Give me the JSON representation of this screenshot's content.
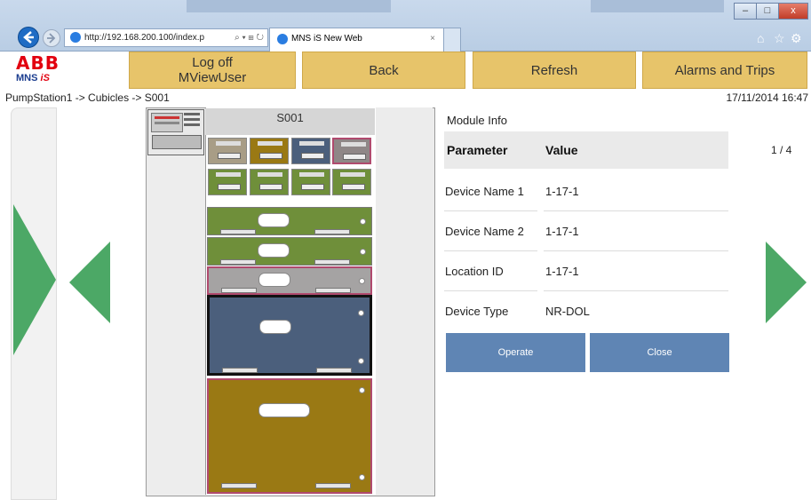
{
  "browser": {
    "url": "http://192.168.200.100/index.p",
    "url_tools": "⌕ ▾ ⊞ ↻",
    "tab_title": "MNS iS New Web",
    "tab_close": "×",
    "window_controls": {
      "minimize": "‒",
      "maximize": "□",
      "close": "x"
    },
    "right_icons": {
      "home": "⌂",
      "favorites": "☆",
      "settings": "⚙"
    }
  },
  "brand": {
    "abb": "ABB",
    "product_main": "MNS",
    "product_suffix": "iS"
  },
  "header": {
    "logoff_line1": "Log off",
    "logoff_line2": "MViewUser",
    "back": "Back",
    "refresh": "Refresh",
    "alarms": "Alarms and Trips"
  },
  "breadcrumb": "PumpStation1 -> Cubicles -> S001",
  "timestamp": "17/11/2014 16:47",
  "cubicle": {
    "title": "S001"
  },
  "module_info": {
    "title": "Module Info",
    "col_param": "Parameter",
    "col_value": "Value",
    "page": "1 / 4",
    "rows": [
      {
        "param": "Device Name 1",
        "value": "1-17-1"
      },
      {
        "param": "Device Name 2",
        "value": "1-17-1"
      },
      {
        "param": "Location ID",
        "value": "1-17-1"
      },
      {
        "param": "Device Type",
        "value": "NR-DOL"
      }
    ]
  },
  "actions": {
    "operate": "Operate",
    "close": "Close"
  },
  "colors": {
    "header_button": "#e7c46a",
    "action_button": "#5f85b4",
    "arrow_green": "#4ca866",
    "drawer_green": "#6f8f3a",
    "drawer_grey": "#a5a3a3",
    "drawer_blue": "#4b5f7c",
    "drawer_gold": "#9a7914"
  },
  "icons": {
    "back": "back-arrow-icon",
    "forward": "forward-arrow-icon",
    "prev": "left-arrow-icon",
    "next": "right-arrow-icon"
  }
}
